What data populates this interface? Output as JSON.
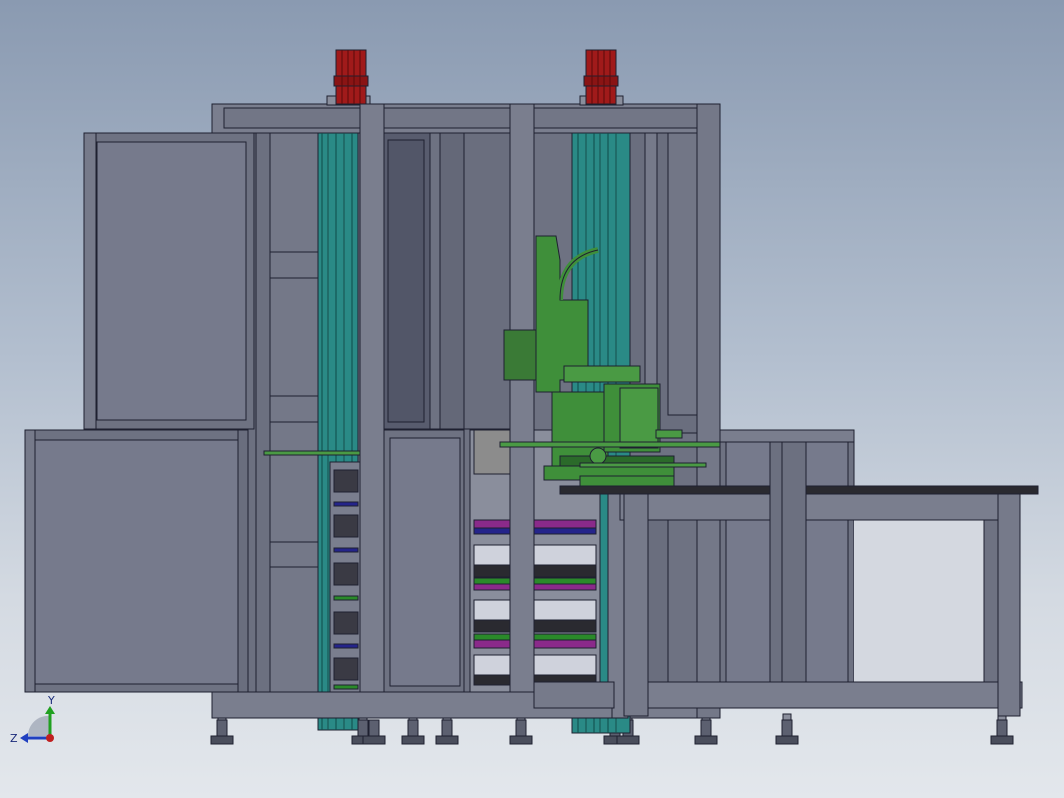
{
  "view": {
    "background_top": "#8a9ab1",
    "background_bottom": "#e3e7ec"
  },
  "colors": {
    "frame": "#6e7282",
    "frame_dark": "#565a6a",
    "panel": "#767a8c",
    "outline": "#1e2030",
    "motor": "#a01a1a",
    "teal": "#2a8a86",
    "robot": "#3f8f3a",
    "robot_dark": "#2b6a2a",
    "conveyor": "#2a2a30",
    "tray_purple": "#8a2a8a",
    "tray_blue": "#24248a",
    "tray_green": "#2a8a2a"
  },
  "triad": {
    "y_label": "Y",
    "z_label": "Z",
    "x_color": "#c02020",
    "y_color": "#20a020",
    "z_color": "#2040c0"
  }
}
